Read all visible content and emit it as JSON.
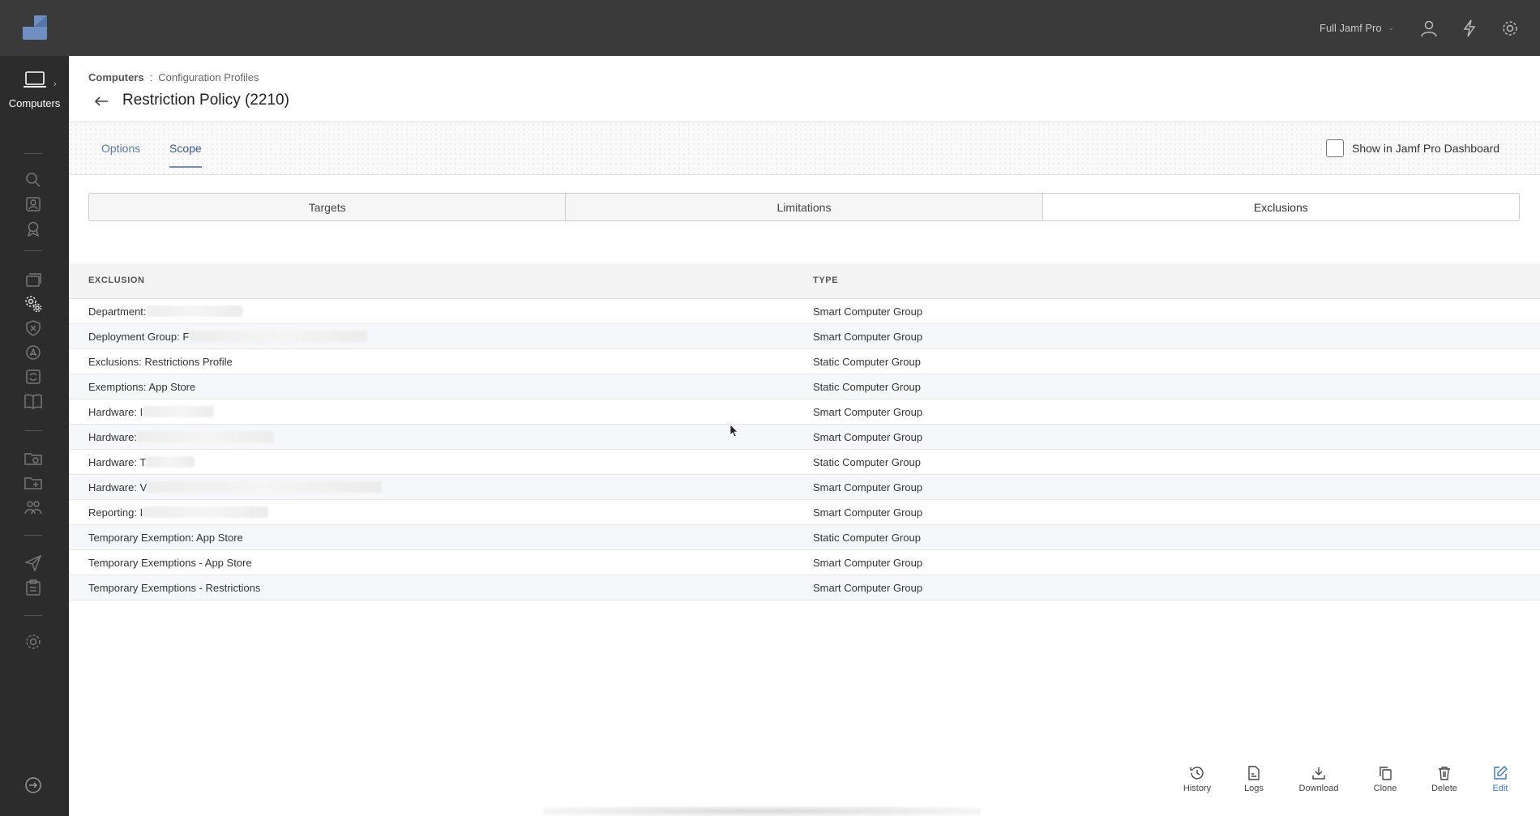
{
  "topbar": {
    "environment": "Full Jamf Pro",
    "icons": [
      "user-icon",
      "lightning-icon",
      "gear-icon"
    ]
  },
  "sidebar": {
    "main_label": "Computers",
    "icons": [
      "search-icon",
      "inventory-icon",
      "badge-icon",
      "stack-icon",
      "settings-gears-icon",
      "shield-icon",
      "app-store-icon",
      "sync-icon",
      "book-icon",
      "folder-sync-icon",
      "folder-add-icon",
      "users-icon",
      "send-icon",
      "clipboard-icon",
      "settings-icon",
      "logout-icon"
    ]
  },
  "breadcrumb": {
    "root": "Computers",
    "separator": ":",
    "current": "Configuration Profiles"
  },
  "page_title": "Restriction Policy (2210)",
  "tabs": [
    {
      "label": "Options",
      "active": false
    },
    {
      "label": "Scope",
      "active": true
    }
  ],
  "dashboard_checkbox": {
    "label": "Show in Jamf Pro Dashboard",
    "checked": false
  },
  "segments": [
    {
      "label": "Targets",
      "active": false
    },
    {
      "label": "Limitations",
      "active": false
    },
    {
      "label": "Exclusions",
      "active": true
    }
  ],
  "table": {
    "headers": {
      "exclusion": "EXCLUSION",
      "type": "TYPE"
    },
    "rows": [
      {
        "exclusion": "Department:",
        "type": "Smart Computer Group"
      },
      {
        "exclusion": "Deployment Group: F",
        "type": "Smart Computer Group"
      },
      {
        "exclusion": "Exclusions: Restrictions Profile",
        "type": "Static Computer Group"
      },
      {
        "exclusion": "Exemptions: App Store",
        "type": "Static Computer Group"
      },
      {
        "exclusion": "Hardware: I",
        "type": "Smart Computer Group"
      },
      {
        "exclusion": "Hardware:",
        "type": "Smart Computer Group"
      },
      {
        "exclusion": "Hardware: T",
        "type": "Static Computer Group"
      },
      {
        "exclusion": "Hardware: V",
        "type": "Smart Computer Group"
      },
      {
        "exclusion": "Reporting: I",
        "type": "Smart Computer Group"
      },
      {
        "exclusion": "Temporary Exemption: App Store",
        "type": "Static Computer Group"
      },
      {
        "exclusion": "Temporary Exemptions - App Store",
        "type": "Smart Computer Group"
      },
      {
        "exclusion": "Temporary Exemptions - Restrictions",
        "type": "Smart Computer Group"
      }
    ]
  },
  "actions": {
    "history": "History",
    "logs": "Logs",
    "download": "Download",
    "clone": "Clone",
    "delete": "Delete",
    "edit": "Edit"
  },
  "colors": {
    "topbar": "#3a3a3a",
    "sidebar": "#2c2c2c",
    "accent": "#3a78c4",
    "tab_active": "#6c8fc5"
  }
}
